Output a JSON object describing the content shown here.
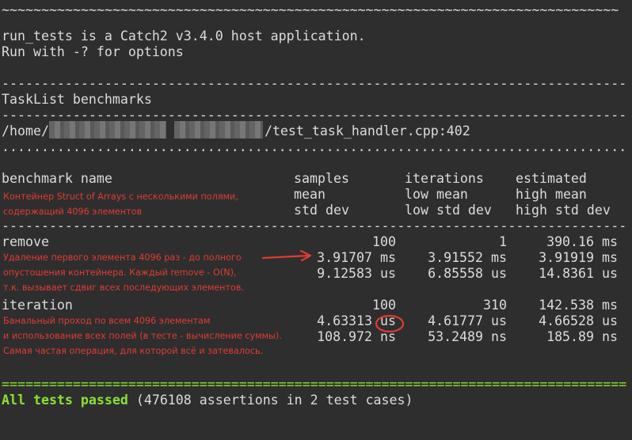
{
  "header": {
    "tilde_rule": "~~~~~~~~~~~~~~~~~~~~~~~~~~~~~~~~~~~~~~~~~~~~~~~~~~~~~~~~~~~~~~~~~~~~~~~~~~~~~~",
    "line1": "run_tests is a Catch2 v3.4.0 host application.",
    "line2": "Run with -? for options"
  },
  "rules": {
    "dash": "-------------------------------------------------------------------------------",
    "dot": "...............................................................................",
    "equals": "==============================================================================="
  },
  "section": {
    "title": "TaskList benchmarks",
    "path_prefix": "/home/",
    "path_suffix": "/test_task_handler.cpp:402"
  },
  "table_header": {
    "name": "benchmark name",
    "samples": "samples",
    "iterations": "iterations",
    "estimated": "estimated",
    "mean": "mean",
    "low_mean": "low mean",
    "high_mean": "high mean",
    "std_dev": "std dev",
    "low_std_dev": "low std dev",
    "high_std_dev": "high std dev"
  },
  "benchmarks": [
    {
      "name": "remove",
      "row1": [
        "100",
        "1",
        "390.16 ms"
      ],
      "row2": [
        "3.91707 ms",
        "3.91552 ms",
        "3.91919 ms"
      ],
      "row3": [
        "9.12583 us",
        "6.85558 us",
        "14.8361 us"
      ]
    },
    {
      "name": "iteration",
      "row1": [
        "100",
        "310",
        "142.538 ms"
      ],
      "row2": [
        "4.63313 us",
        "4.61777 us",
        "4.66528 us"
      ],
      "row3": [
        "108.972 ns",
        "53.2489 ns",
        "185.89 ns"
      ]
    }
  ],
  "annotations": {
    "header_note": "Контейнер Struct of Arrays с несколькими полями,\nсодержащий 4096 элементов",
    "remove_note": "Удаление первого элемента 4096 раз - до полного\nопустошения контейнера. Каждый remove - O(N),\nт.к. вызывает сдвиг всех последующих элементов.",
    "iteration_note": "Банальный проход по всем 4096 элементам\nи использование всех полей (в тесте - вычисление суммы).\nСамая частая операция, для которой всё и затевалось."
  },
  "summary": {
    "passed": "All tests passed",
    "details": " (476108 assertions in 2 test cases)"
  },
  "colors": {
    "background": "#2e2e2e",
    "text": "#dcdcdc",
    "pass_green": "#8ae234",
    "annotation_red": "#e03c31"
  }
}
